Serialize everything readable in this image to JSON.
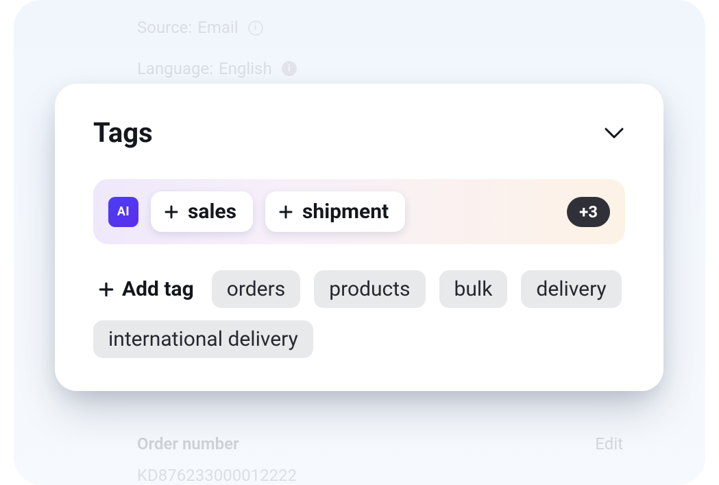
{
  "background": {
    "source_label": "Source:",
    "source_value": "Email",
    "language_label": "Language:",
    "language_value": "English",
    "order_number_label": "Order number",
    "edit_label": "Edit",
    "order_number_value": "KD876233000012222"
  },
  "card": {
    "title": "Tags",
    "ai_badge": "AI",
    "ai_suggestions": [
      "sales",
      "shipment"
    ],
    "ai_more": "+3",
    "add_tag_label": "Add tag",
    "existing_tags": [
      "orders",
      "products",
      "bulk",
      "delivery",
      "international delivery"
    ]
  }
}
